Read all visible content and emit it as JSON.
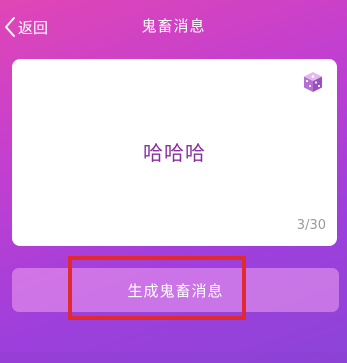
{
  "header": {
    "back_label": "返回",
    "title": "鬼畜消息"
  },
  "card": {
    "dice_icon": "dice-icon",
    "message_text": "哈哈哈",
    "counter": "3/30"
  },
  "action": {
    "generate_label": "生成鬼畜消息"
  },
  "colors": {
    "accent": "#e146b5",
    "message_text": "#8a2f9e",
    "highlight_border": "#e02a2f"
  }
}
